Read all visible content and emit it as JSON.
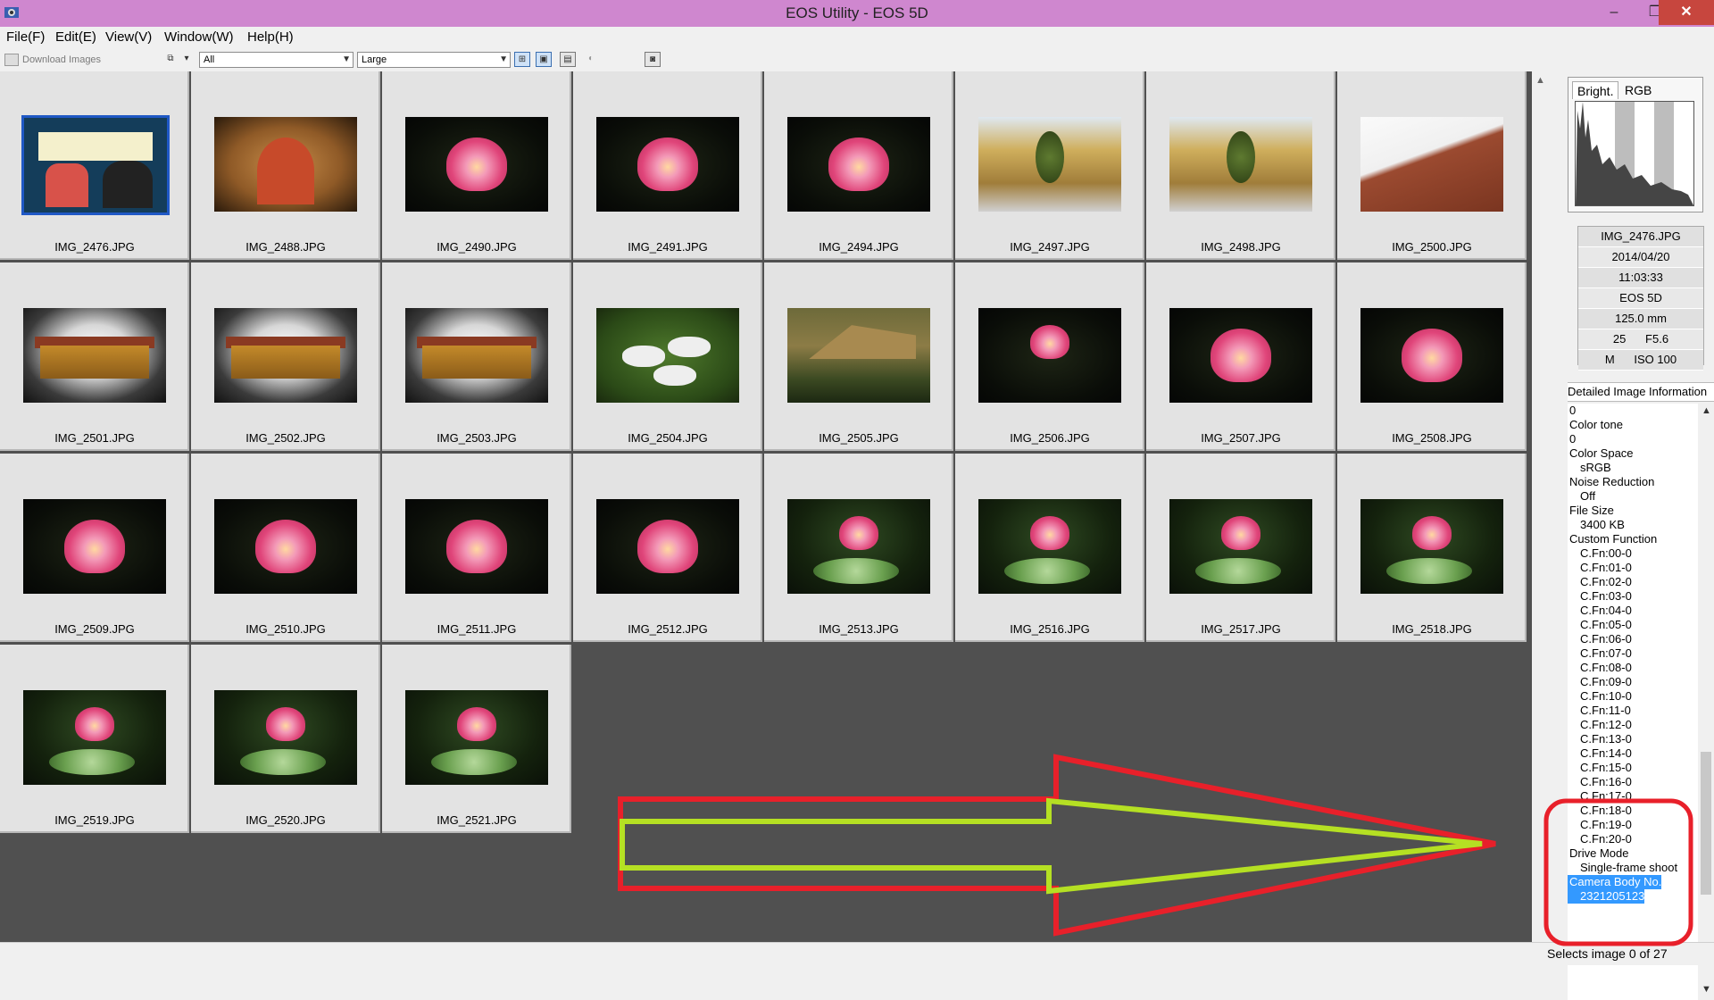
{
  "window": {
    "title": "EOS Utility - EOS 5D",
    "minimize": "–",
    "maximize": "❐",
    "close": "✕"
  },
  "menu": [
    "File(F)",
    "Edit(E)",
    "View(V)",
    "Window(W)",
    "Help(H)"
  ],
  "toolbar": {
    "download_label": "Download Images",
    "filter_value": "All",
    "size_value": "Large"
  },
  "thumbnails": [
    {
      "name": "IMG_2476.JPG",
      "kind": "poster",
      "selected": true
    },
    {
      "name": "IMG_2488.JPG",
      "kind": "door"
    },
    {
      "name": "IMG_2490.JPG",
      "kind": "lotus"
    },
    {
      "name": "IMG_2491.JPG",
      "kind": "lotus"
    },
    {
      "name": "IMG_2494.JPG",
      "kind": "lotus"
    },
    {
      "name": "IMG_2497.JPG",
      "kind": "court"
    },
    {
      "name": "IMG_2498.JPG",
      "kind": "court"
    },
    {
      "name": "IMG_2500.JPG",
      "kind": "roof"
    },
    {
      "name": "IMG_2501.JPG",
      "kind": "building"
    },
    {
      "name": "IMG_2502.JPG",
      "kind": "building"
    },
    {
      "name": "IMG_2503.JPG",
      "kind": "building"
    },
    {
      "name": "IMG_2504.JPG",
      "kind": "pigs"
    },
    {
      "name": "IMG_2505.JPG",
      "kind": "hut"
    },
    {
      "name": "IMG_2506.JPG",
      "kind": "lotus-small"
    },
    {
      "name": "IMG_2507.JPG",
      "kind": "lotus"
    },
    {
      "name": "IMG_2508.JPG",
      "kind": "lotus"
    },
    {
      "name": "IMG_2509.JPG",
      "kind": "lotus"
    },
    {
      "name": "IMG_2510.JPG",
      "kind": "lotus"
    },
    {
      "name": "IMG_2511.JPG",
      "kind": "lotus"
    },
    {
      "name": "IMG_2512.JPG",
      "kind": "lotus"
    },
    {
      "name": "IMG_2513.JPG",
      "kind": "lotus-leaf"
    },
    {
      "name": "IMG_2516.JPG",
      "kind": "lotus-leaf"
    },
    {
      "name": "IMG_2517.JPG",
      "kind": "lotus-leaf"
    },
    {
      "name": "IMG_2518.JPG",
      "kind": "lotus-leaf"
    },
    {
      "name": "IMG_2519.JPG",
      "kind": "lotus-leaf"
    },
    {
      "name": "IMG_2520.JPG",
      "kind": "lotus-leaf"
    },
    {
      "name": "IMG_2521.JPG",
      "kind": "lotus-leaf"
    }
  ],
  "histogram": {
    "tab_bright": "Bright.",
    "tab_rgb": "RGB",
    "active_tab": "Bright."
  },
  "image_info": {
    "filename": "IMG_2476.JPG",
    "date": "2014/04/20",
    "time": "11:03:33",
    "camera": "EOS 5D",
    "focal_length": "125.0 mm",
    "exposure": "25      F5.6",
    "mode_iso": "M      ISO 100"
  },
  "detail": {
    "header": "Detailed Image Information",
    "items": [
      {
        "text": "0",
        "sub": false
      },
      {
        "text": "Color tone",
        "sub": false
      },
      {
        "text": "0",
        "sub": false
      },
      {
        "text": "Color Space",
        "sub": false
      },
      {
        "text": "sRGB",
        "sub": true
      },
      {
        "text": "Noise Reduction",
        "sub": false
      },
      {
        "text": "Off",
        "sub": true
      },
      {
        "text": "File Size",
        "sub": false
      },
      {
        "text": "3400 KB",
        "sub": true
      },
      {
        "text": "Custom Function",
        "sub": false
      },
      {
        "text": "C.Fn:00-0",
        "sub": true
      },
      {
        "text": "C.Fn:01-0",
        "sub": true
      },
      {
        "text": "C.Fn:02-0",
        "sub": true
      },
      {
        "text": "C.Fn:03-0",
        "sub": true
      },
      {
        "text": "C.Fn:04-0",
        "sub": true
      },
      {
        "text": "C.Fn:05-0",
        "sub": true
      },
      {
        "text": "C.Fn:06-0",
        "sub": true
      },
      {
        "text": "C.Fn:07-0",
        "sub": true
      },
      {
        "text": "C.Fn:08-0",
        "sub": true
      },
      {
        "text": "C.Fn:09-0",
        "sub": true
      },
      {
        "text": "C.Fn:10-0",
        "sub": true
      },
      {
        "text": "C.Fn:11-0",
        "sub": true
      },
      {
        "text": "C.Fn:12-0",
        "sub": true
      },
      {
        "text": "C.Fn:13-0",
        "sub": true
      },
      {
        "text": "C.Fn:14-0",
        "sub": true
      },
      {
        "text": "C.Fn:15-0",
        "sub": true
      },
      {
        "text": "C.Fn:16-0",
        "sub": true
      },
      {
        "text": "C.Fn:17-0",
        "sub": true
      },
      {
        "text": "C.Fn:18-0",
        "sub": true
      },
      {
        "text": "C.Fn:19-0",
        "sub": true
      },
      {
        "text": "C.Fn:20-0",
        "sub": true
      },
      {
        "text": "Drive Mode",
        "sub": false
      },
      {
        "text": "Single-frame shoot",
        "sub": true
      },
      {
        "text": "Camera Body No.",
        "sub": false,
        "selected": true
      },
      {
        "text": "2321205123",
        "sub": true,
        "selected": true
      }
    ]
  },
  "status": {
    "text": "Selects image 0 of 27"
  },
  "colors": {
    "titlebar": "#cf87cf",
    "grid_bg": "#505050",
    "selection": "#3399ff",
    "annotation_red": "#e8202a",
    "annotation_green": "#b5e023"
  }
}
